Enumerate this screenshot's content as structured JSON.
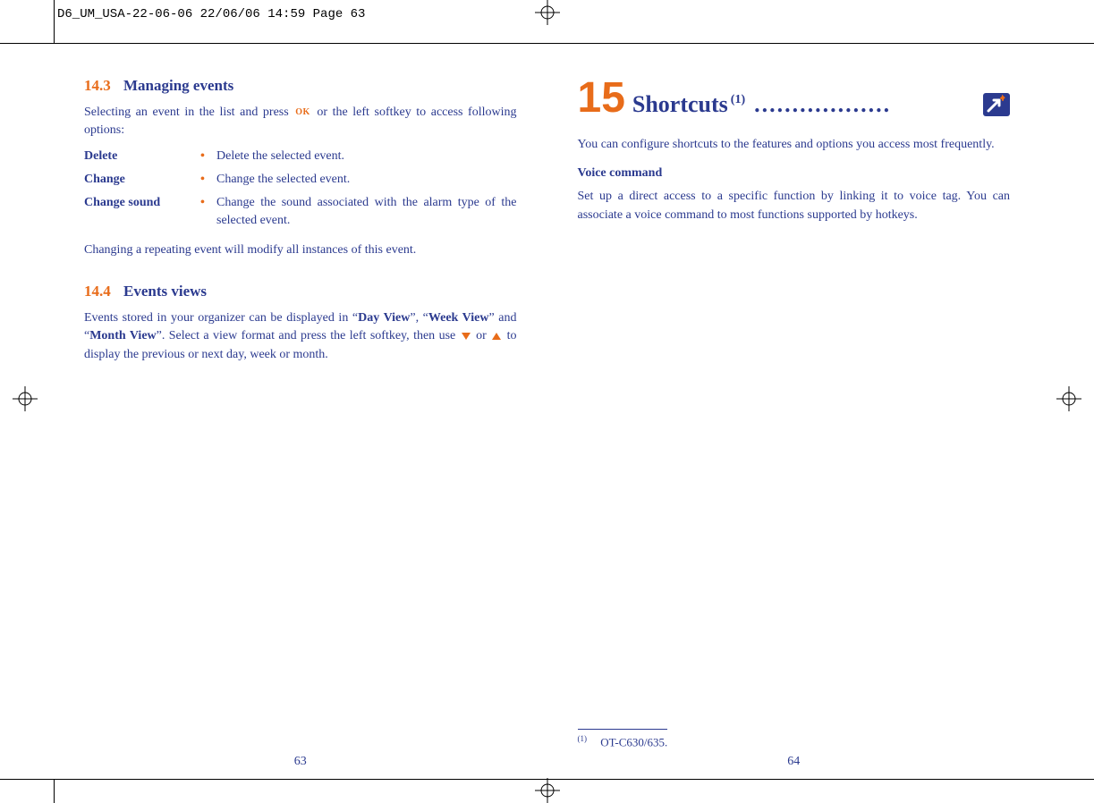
{
  "preheader": "D6_UM_USA-22-06-06  22/06/06  14:59  Page 63",
  "left": {
    "section1": {
      "num": "14.3",
      "title": "Managing events",
      "intro_a": "Selecting an event in the list and press ",
      "intro_b": " or the left softkey to access following options:",
      "options": [
        {
          "label": "Delete",
          "desc": "Delete the selected event."
        },
        {
          "label": "Change",
          "desc": "Change the selected event."
        },
        {
          "label": "Change sound",
          "desc": "Change the sound associated with the alarm type of the selected event."
        }
      ],
      "note": "Changing a repeating event will modify all instances of this event."
    },
    "section2": {
      "num": "14.4",
      "title": "Events views",
      "para_a": "Events stored in your organizer can be displayed in “",
      "bold1": "Day View",
      "mid1": "”, “",
      "bold2": "Week View",
      "mid2": "” and “",
      "bold3": "Month View",
      "para_b": "”. Select a view format and press the left softkey, then use ",
      "para_c": " or ",
      "para_d": " to display the previous or next day, week or month."
    },
    "page_num": "63"
  },
  "right": {
    "chapter_num": "15",
    "chapter_title": "Shortcuts",
    "chapter_sup": "(1)",
    "dots": "..................",
    "para1": "You can configure shortcuts to the features and options you access most frequently.",
    "sub_heading": "Voice command",
    "para2": "Set up a direct access to a specific function by linking it to voice tag. You can associate a voice command to most functions supported by hotkeys.",
    "footnote_mark": "(1)",
    "footnote_text": "OT-C630/635.",
    "page_num": "64"
  }
}
